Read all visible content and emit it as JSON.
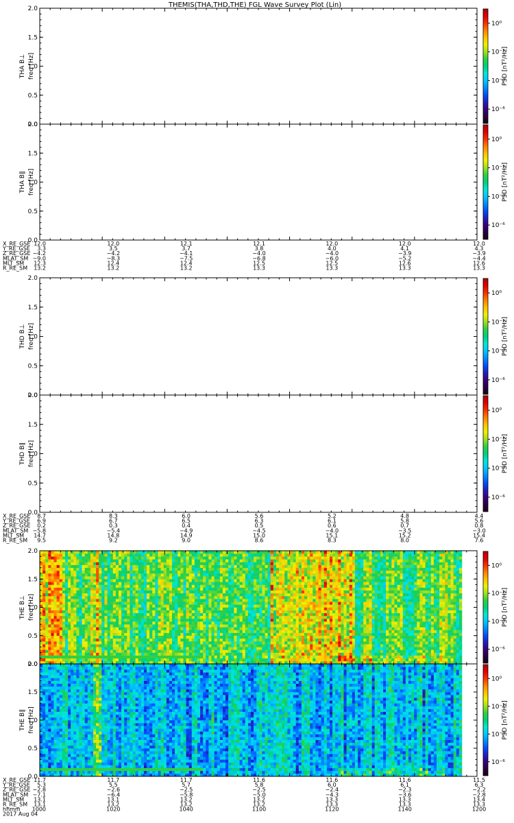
{
  "title": "THEMIS(THA,THD,THE) FGL Wave Survey Plot (Lin)",
  "colors": {
    "axis": "#000000",
    "background": "#ffffff"
  },
  "colorbar": {
    "label": "PSD [nT²/Hz]",
    "stops": [
      "#1a001a",
      "#2a0040",
      "#3a0080",
      "#2020c0",
      "#0050ff",
      "#0090ff",
      "#00c8ff",
      "#00e8d0",
      "#00d080",
      "#30d040",
      "#a0e020",
      "#f0f000",
      "#ffc000",
      "#ff8000",
      "#ff3000",
      "#e00000",
      "#b00000"
    ],
    "tick_labels": [
      "10⁰",
      "10⁻²",
      "10⁻⁴",
      "10⁻⁶"
    ],
    "tick_values": [
      0,
      -2,
      -4,
      -6
    ],
    "range_log10": [
      -7,
      1
    ]
  },
  "chart_data": [
    {
      "type": "heatmap",
      "ylabel": "THA B⊥",
      "unit_label": "freq [Hz]",
      "y_ticks": [
        "0.0",
        "0.5",
        "1.0",
        "1.5",
        "2.0"
      ],
      "ylim": [
        0,
        2
      ],
      "has_data": false
    },
    {
      "type": "heatmap",
      "ylabel": "THA B∥",
      "unit_label": "freq [Hz]",
      "y_ticks": [
        "0.0",
        "0.5",
        "1.0",
        "1.5",
        "2.0"
      ],
      "ylim": [
        0,
        2
      ],
      "has_data": false
    },
    {
      "type": "heatmap",
      "ylabel": "THD B⊥",
      "unit_label": "freq [Hz]",
      "y_ticks": [
        "0.0",
        "0.5",
        "1.0",
        "1.5",
        "2.0"
      ],
      "ylim": [
        0,
        2
      ],
      "has_data": false
    },
    {
      "type": "heatmap",
      "ylabel": "THD B∥",
      "unit_label": "freq [Hz]",
      "y_ticks": [
        "0.0",
        "0.5",
        "1.0",
        "1.5",
        "2.0"
      ],
      "ylim": [
        0,
        2
      ],
      "has_data": false
    },
    {
      "type": "heatmap",
      "ylabel": "THE B⊥",
      "unit_label": "freq [Hz]",
      "y_ticks": [
        "0.0",
        "0.5",
        "1.0",
        "1.5",
        "2.0"
      ],
      "ylim": [
        0,
        2
      ],
      "has_data": true,
      "time_range": [
        "1000",
        "1157"
      ],
      "typical_log10_psd": -2.5,
      "enhanced_intervals": [
        "1000-1008",
        "1018-1022",
        "1125-1157"
      ]
    },
    {
      "type": "heatmap",
      "ylabel": "THE B∥",
      "unit_label": "freq [Hz]",
      "y_ticks": [
        "0.0",
        "0.5",
        "1.0",
        "1.5",
        "2.0"
      ],
      "ylim": [
        0,
        2
      ],
      "has_data": true,
      "time_range": [
        "1000",
        "1157"
      ],
      "typical_log10_psd": -4.0,
      "enhanced_intervals": [
        "1018-1022"
      ]
    }
  ],
  "ephemeris": [
    {
      "labels": [
        "X_RE_GSE",
        "Y_RE_GSE",
        "Z_RE_GSE",
        "MLAT_SM",
        "MLT_SM",
        "R_RE_SM"
      ],
      "columns": [
        [
          "12.0",
          "3.3",
          "−4.2",
          "−9.0",
          "12.3",
          "13.2"
        ],
        [
          "12.0",
          "3.5",
          "−4.2",
          "−8.3",
          "12.4",
          "13.2"
        ],
        [
          "12.1",
          "3.7",
          "−4.1",
          "−7.5",
          "12.4",
          "13.2"
        ],
        [
          "12.1",
          "3.8",
          "−4.0",
          "−6.8",
          "12.5",
          "13.3"
        ],
        [
          "12.0",
          "4.0",
          "−4.0",
          "−6.0",
          "12.5",
          "13.3"
        ],
        [
          "12.0",
          "4.1",
          "−3.9",
          "−5.2",
          "12.6",
          "13.3"
        ],
        [
          "12.0",
          "4.3",
          "−3.9",
          "−4.4",
          "12.6",
          "13.3"
        ]
      ]
    },
    {
      "labels": [
        "X_RE_GSE",
        "Y_RE_GSE",
        "Z_RE_GSE",
        "MLAT_SM",
        "MLT_SM",
        "R_RE_SM"
      ],
      "columns": [
        [
          "8.7",
          "6.9",
          "0.2",
          "−5.8",
          "14.7",
          "9.5"
        ],
        [
          "8.3",
          "6.7",
          "0.3",
          "−5.4",
          "14.8",
          "9.2"
        ],
        [
          "6.0",
          "6.5",
          "0.4",
          "−4.9",
          "14.9",
          "9.0"
        ],
        [
          "5.6",
          "6.3",
          "0.5",
          "−4.5",
          "15.0",
          "8.6"
        ],
        [
          "5.2",
          "6.1",
          "0.6",
          "−4.0",
          "15.1",
          "8.3"
        ],
        [
          "4.8",
          "5.8",
          "0.7",
          "−3.5",
          "15.2",
          "8.0"
        ],
        [
          "4.4",
          "5.6",
          "0.8",
          "−3.0",
          "15.4",
          "7.6"
        ]
      ]
    },
    {
      "labels": [
        "X_RE_GSE",
        "Y_RE_GSE",
        "Z_RE_GSE",
        "MLAT_SM",
        "MLT_SM",
        "R_RE_SM",
        "hhmm",
        "2017 Aug 04"
      ],
      "columns": [
        [
          "11.7",
          "5.3",
          "−2.8",
          "−7.1",
          "13.1",
          "13.1",
          "1000"
        ],
        [
          "11.7",
          "5.5",
          "−2.6",
          "−6.4",
          "13.1",
          "13.2",
          "1020"
        ],
        [
          "11.7",
          "5.7",
          "−2.5",
          "−5.8",
          "13.2",
          "13.2",
          "1040"
        ],
        [
          "11.6",
          "5.8",
          "−2.5",
          "−5.0",
          "13.2",
          "13.2",
          "1100"
        ],
        [
          "11.6",
          "6.0",
          "−2.4",
          "−4.3",
          "13.3",
          "13.3",
          "1120"
        ],
        [
          "11.6",
          "6.1",
          "−2.3",
          "−3.6",
          "13.3",
          "13.3",
          "1140"
        ],
        [
          "11.5",
          "6.3",
          "−2.2",
          "−2.8",
          "13.4",
          "13.3",
          "1200"
        ]
      ]
    }
  ]
}
